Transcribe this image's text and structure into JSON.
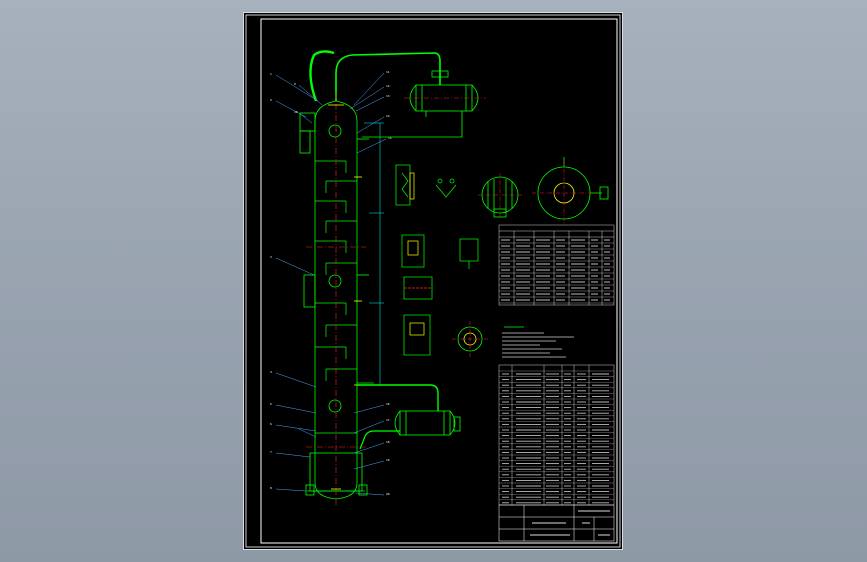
{
  "viewer": {
    "background_color": "#9aa5b1",
    "sheet_color": "#000000"
  },
  "drawing": {
    "description_visible": false,
    "colors": {
      "border": "#ffffff",
      "equipment": "#00ff00",
      "centerline": "#ff2020",
      "dimension": "#00ffff",
      "leader": "#4da6ff",
      "annotation": "#ffffff",
      "accent": "#ffff00"
    },
    "icons": [
      "distillation-column-icon",
      "condenser-icon",
      "reboiler-icon",
      "flange-detail-icon",
      "manway-section-icon"
    ]
  }
}
